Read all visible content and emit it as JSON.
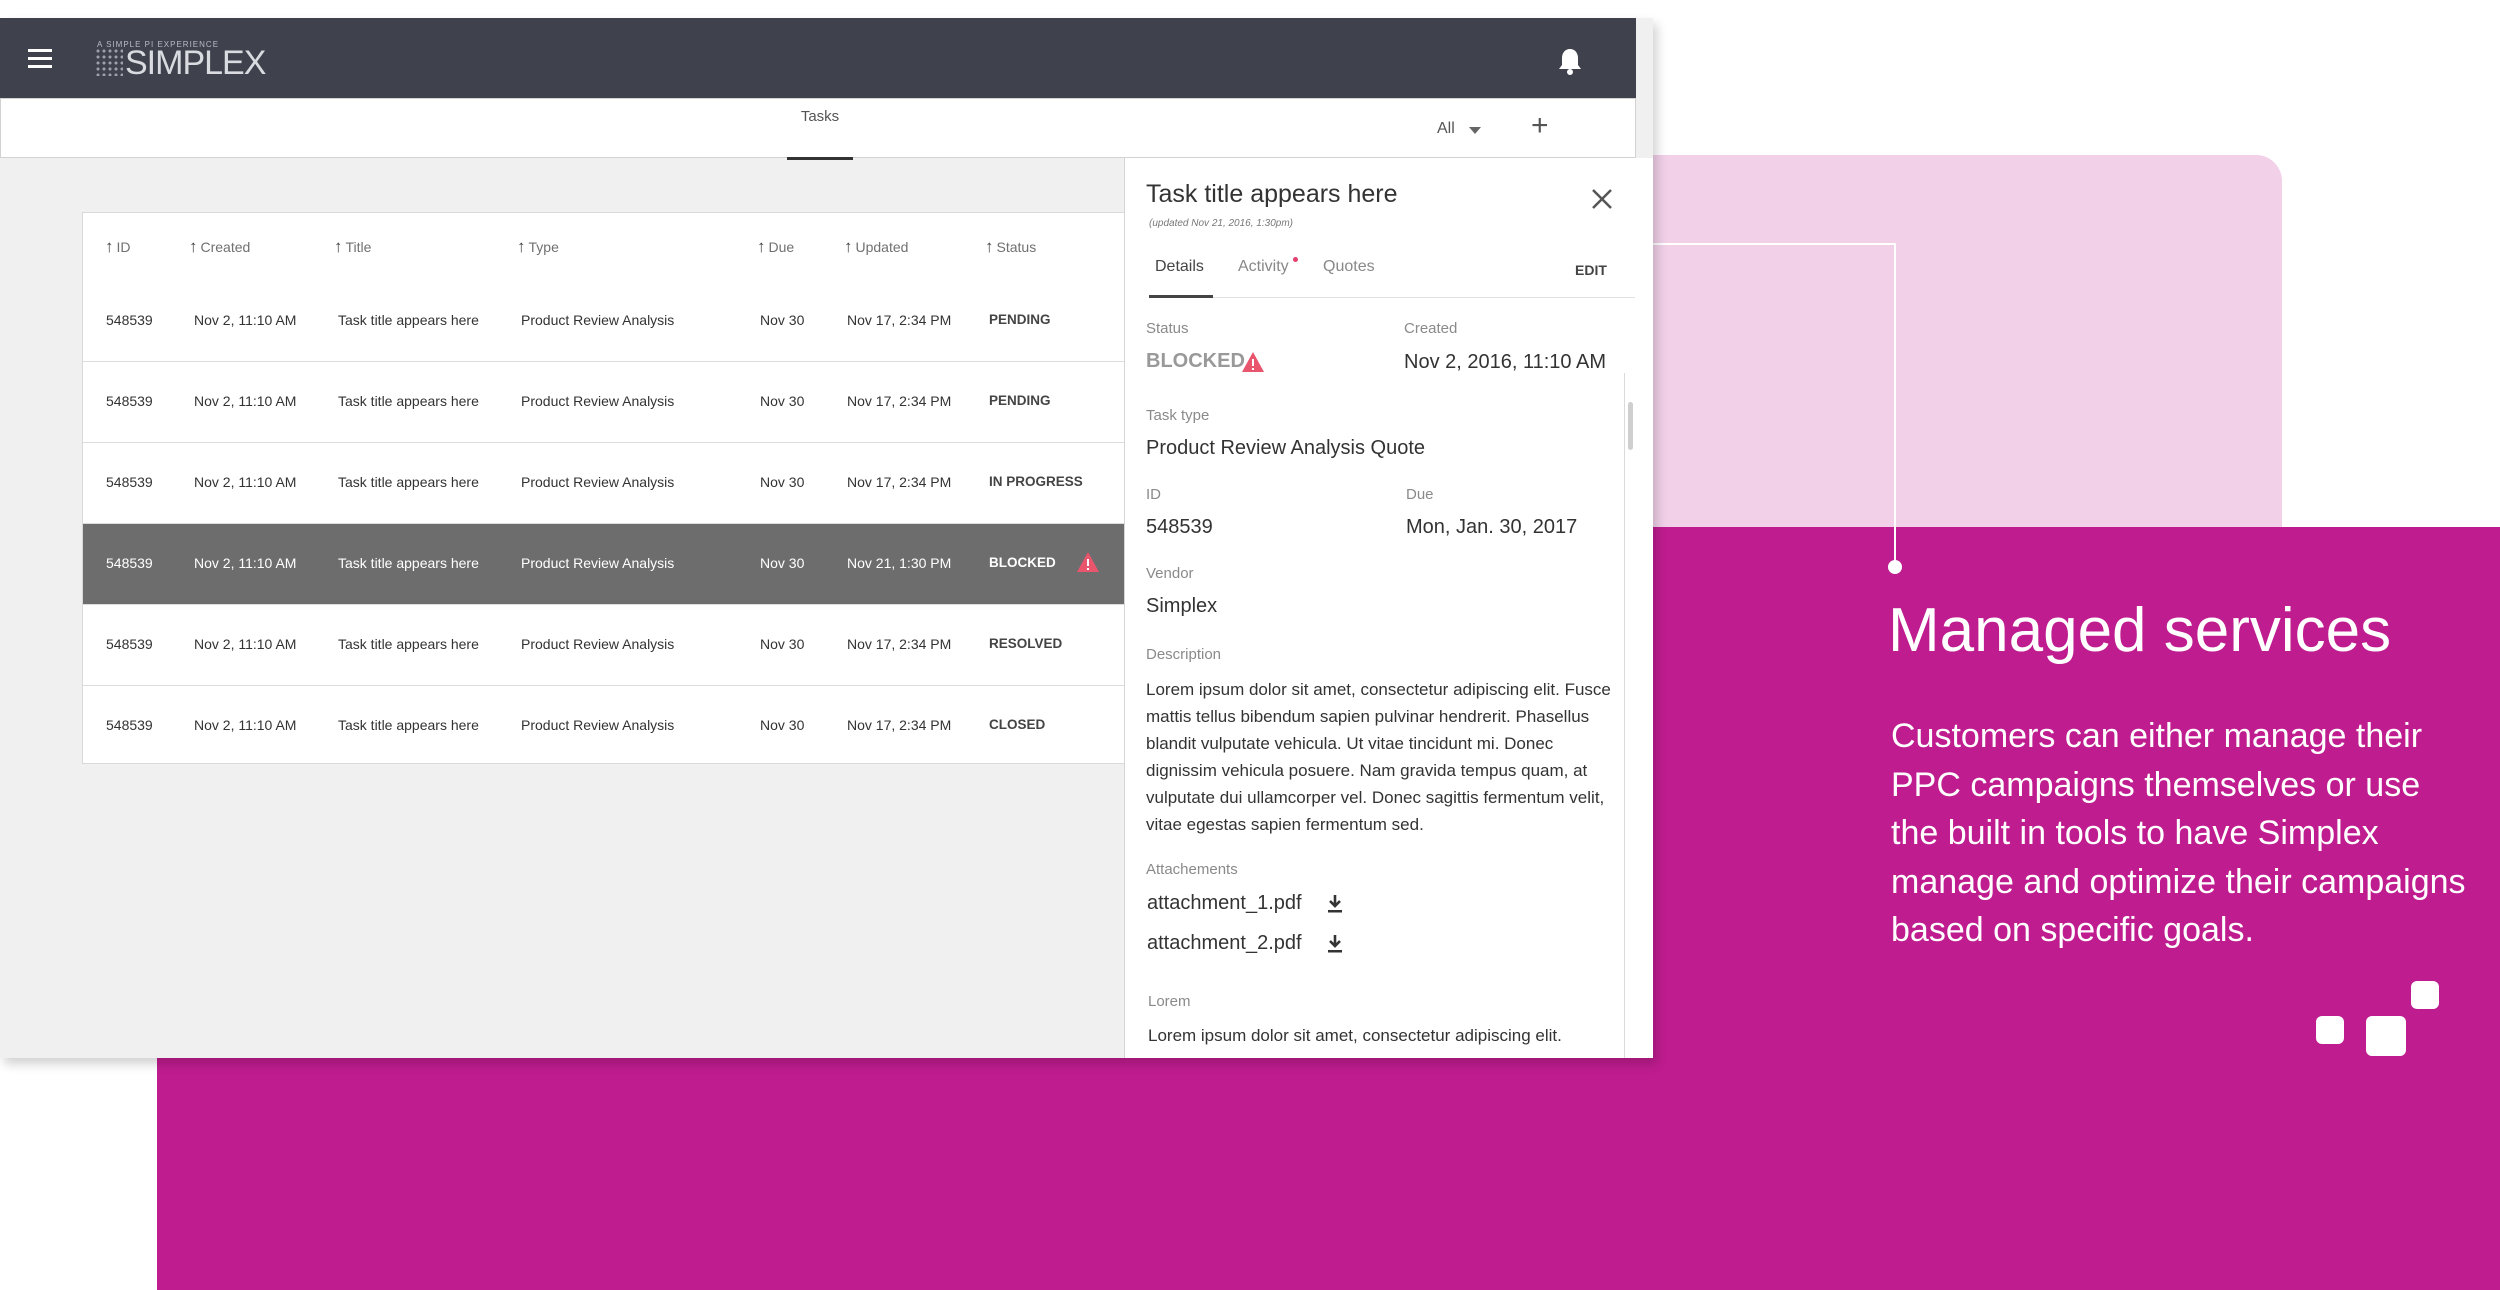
{
  "app": {
    "brand": "SIMPLEX",
    "brand_tagline": "A SIMPLE PI EXPERIENCE",
    "tab": "Tasks",
    "filter": "All"
  },
  "table": {
    "headers": [
      "ID",
      "Created",
      "Title",
      "Type",
      "Due",
      "Updated",
      "Status"
    ],
    "rows": [
      {
        "id": "548539",
        "created": "Nov 2, 11:10 AM",
        "title": "Task title appears here",
        "type": "Product Review Analysis",
        "due": "Nov 30",
        "updated": "Nov 17, 2:34 PM",
        "status": "PENDING"
      },
      {
        "id": "548539",
        "created": "Nov 2, 11:10 AM",
        "title": "Task title appears here",
        "type": "Product Review Analysis",
        "due": "Nov 30",
        "updated": "Nov 17, 2:34 PM",
        "status": "PENDING"
      },
      {
        "id": "548539",
        "created": "Nov 2, 11:10 AM",
        "title": "Task title appears here",
        "type": "Product Review Analysis",
        "due": "Nov 30",
        "updated": "Nov 17, 2:34 PM",
        "status": "IN PROGRESS"
      },
      {
        "id": "548539",
        "created": "Nov 2, 11:10 AM",
        "title": "Task title appears here",
        "type": "Product Review Analysis",
        "due": "Nov 30",
        "updated": "Nov 21, 1:30 PM",
        "status": "BLOCKED"
      },
      {
        "id": "548539",
        "created": "Nov 2, 11:10 AM",
        "title": "Task title appears here",
        "type": "Product Review Analysis",
        "due": "Nov 30",
        "updated": "Nov 17, 2:34 PM",
        "status": "RESOLVED"
      },
      {
        "id": "548539",
        "created": "Nov 2, 11:10 AM",
        "title": "Task title appears here",
        "type": "Product Review Analysis",
        "due": "Nov 30",
        "updated": "Nov 17, 2:34 PM",
        "status": "CLOSED"
      }
    ]
  },
  "panel": {
    "title": "Task title appears here",
    "updated": "(updated Nov 21, 2016, 1:30pm)",
    "tabs": [
      "Details",
      "Activity",
      "Quotes"
    ],
    "edit": "EDIT",
    "status_label": "Status",
    "status_value": "BLOCKED",
    "created_label": "Created",
    "created_value": "Nov 2, 2016, 11:10 AM",
    "task_type_label": "Task type",
    "task_type_value": "Product Review Analysis Quote",
    "id_label": "ID",
    "id_value": "548539",
    "due_label": "Due",
    "due_value": "Mon, Jan. 30, 2017",
    "vendor_label": "Vendor",
    "vendor_value": "Simplex",
    "description_label": "Description",
    "description": "Lorem ipsum dolor sit amet, consectetur adipiscing elit. Fusce mattis tellus bibendum sapien pulvinar hendrerit. Phasellus blandit vulputate vehicula. Ut vitae tincidunt mi. Donec dignissim vehicula posuere. Nam gravida tempus quam, at vulputate dui ullamcorper vel. Donec sagittis fermentum velit, vitae egestas sapien fermentum sed.",
    "attachments_label": "Attachements",
    "attachments": [
      "attachment_1.pdf",
      "attachment_2.pdf"
    ],
    "lorem_label": "Lorem",
    "lorem_value": "Lorem ipsum dolor sit amet, consectetur adipiscing elit."
  },
  "promo": {
    "title": "Managed services",
    "body": "Customers can either manage their PPC campaigns themselves or use the built in tools to have Simplex manage and optimize their campaigns based on specific goals."
  },
  "colors": {
    "magenta": "#bf1c8f",
    "pink_light": "#f1d0e8",
    "topbar": "#3f424c",
    "selected_row": "#6d6d6d",
    "warning": "#e8556d"
  }
}
